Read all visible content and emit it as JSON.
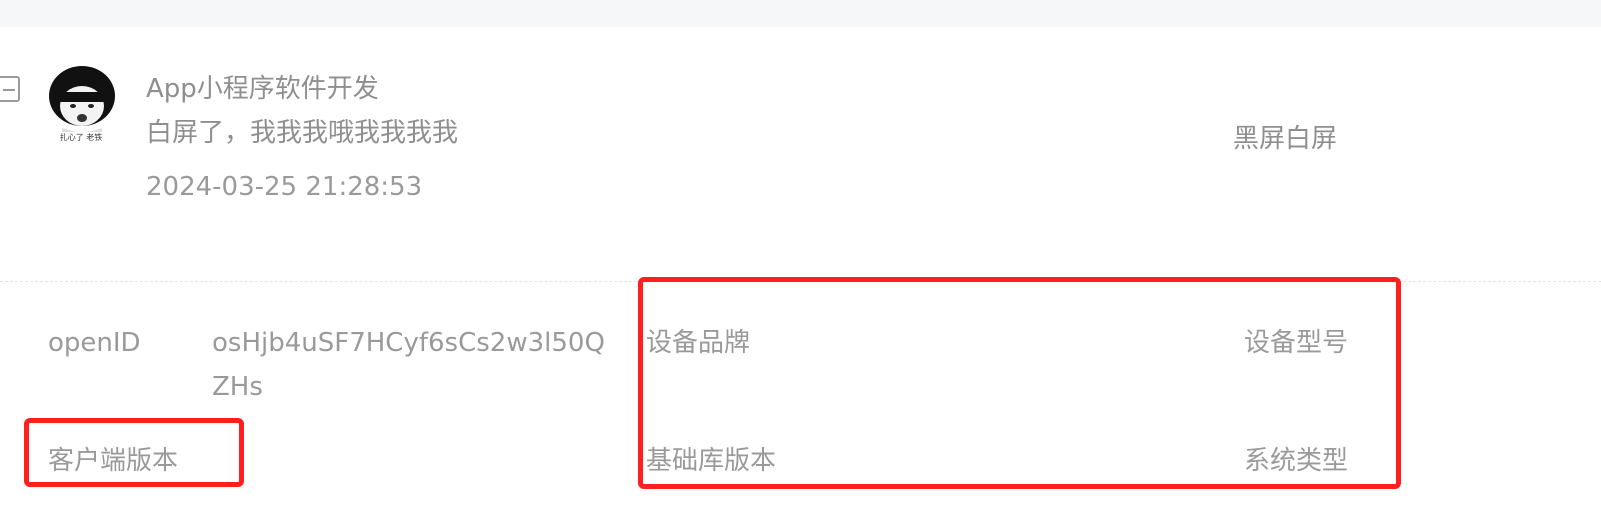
{
  "message": {
    "title": "App小程序软件开发",
    "content": "白屏了，我我我哦我我我我",
    "time": "2024-03-25 21:28:53",
    "category": "黑屏白屏",
    "avatar_caption": "扎心了 老铁"
  },
  "info": {
    "openid_label": "openID",
    "openid_line1": "osHjb4uSF7HCyf6sCs2w3l50Q",
    "openid_line2": "ZHs",
    "device_brand_label": "设备品牌",
    "device_model_label": "设备型号",
    "client_version_label": "客户端版本",
    "base_lib_version_label": "基础库版本",
    "system_type_label": "系统类型"
  },
  "colors": {
    "text": "#9a9a9a",
    "highlight": "#ff1f1f",
    "topbar": "#f6f7f9"
  }
}
